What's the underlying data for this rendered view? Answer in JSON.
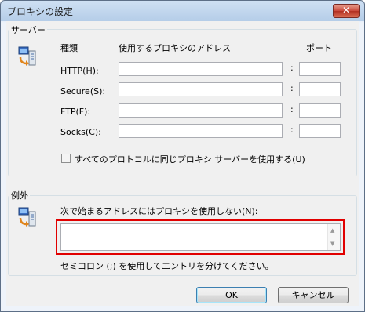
{
  "window": {
    "title": "プロキシの設定",
    "close_glyph": "✕"
  },
  "servers": {
    "legend": "サーバー",
    "col_type": "種類",
    "col_address": "使用するプロキシのアドレス",
    "col_port": "ポート",
    "rows": [
      {
        "label": "HTTP(H):",
        "address": "",
        "port": ""
      },
      {
        "label": "Secure(S):",
        "address": "",
        "port": ""
      },
      {
        "label": "FTP(F):",
        "address": "",
        "port": ""
      },
      {
        "label": "Socks(C):",
        "address": "",
        "port": ""
      }
    ],
    "separator": ":",
    "same_proxy_label": "すべてのプロトコルに同じプロキシ サーバーを使用する(U)",
    "same_proxy_checked": false
  },
  "exceptions": {
    "legend": "例外",
    "prompt": "次で始まるアドレスにはプロキシを使用しない(N):",
    "value": "",
    "hint": "セミコロン (;) を使用してエントリを分けてください。"
  },
  "buttons": {
    "ok": "OK",
    "cancel": "キャンセル"
  },
  "colors": {
    "highlight": "#e10000",
    "title_bar": "#b5cde8"
  }
}
